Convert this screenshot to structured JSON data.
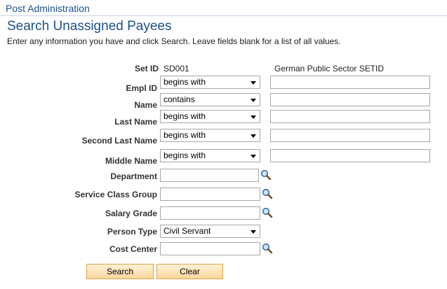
{
  "breadcrumb": "Post Administration",
  "title": "Search Unassigned Payees",
  "instructions": "Enter any information you have and click Search. Leave fields blank for a list of all values.",
  "setid": {
    "label": "Set ID",
    "value": "SD001",
    "description": "German Public Sector SETID"
  },
  "emplid": {
    "label": "Empl ID",
    "operator": "begins with",
    "value": ""
  },
  "name": {
    "label": "Name",
    "operator": "contains",
    "value": ""
  },
  "last_name": {
    "label": "Last Name",
    "operator": "begins with",
    "value": ""
  },
  "second_last_name": {
    "label": "Second Last Name",
    "operator": "begins with",
    "value": ""
  },
  "middle_name": {
    "label": "Middle Name",
    "operator": "begins with",
    "value": ""
  },
  "department": {
    "label": "Department",
    "value": ""
  },
  "service_class_group": {
    "label": "Service Class Group",
    "value": ""
  },
  "salary_grade": {
    "label": "Salary Grade",
    "value": ""
  },
  "person_type": {
    "label": "Person Type",
    "selected": "Civil Servant"
  },
  "cost_center": {
    "label": "Cost Center",
    "value": ""
  },
  "buttons": {
    "search": "Search",
    "clear": "Clear"
  },
  "icons": {
    "lookup": "magnifying-glass-icon",
    "dropdown": "chevron-down-icon"
  },
  "colors": {
    "title": "#1c5189",
    "button_bg": "#fbd79e",
    "button_border": "#d9a54a"
  }
}
